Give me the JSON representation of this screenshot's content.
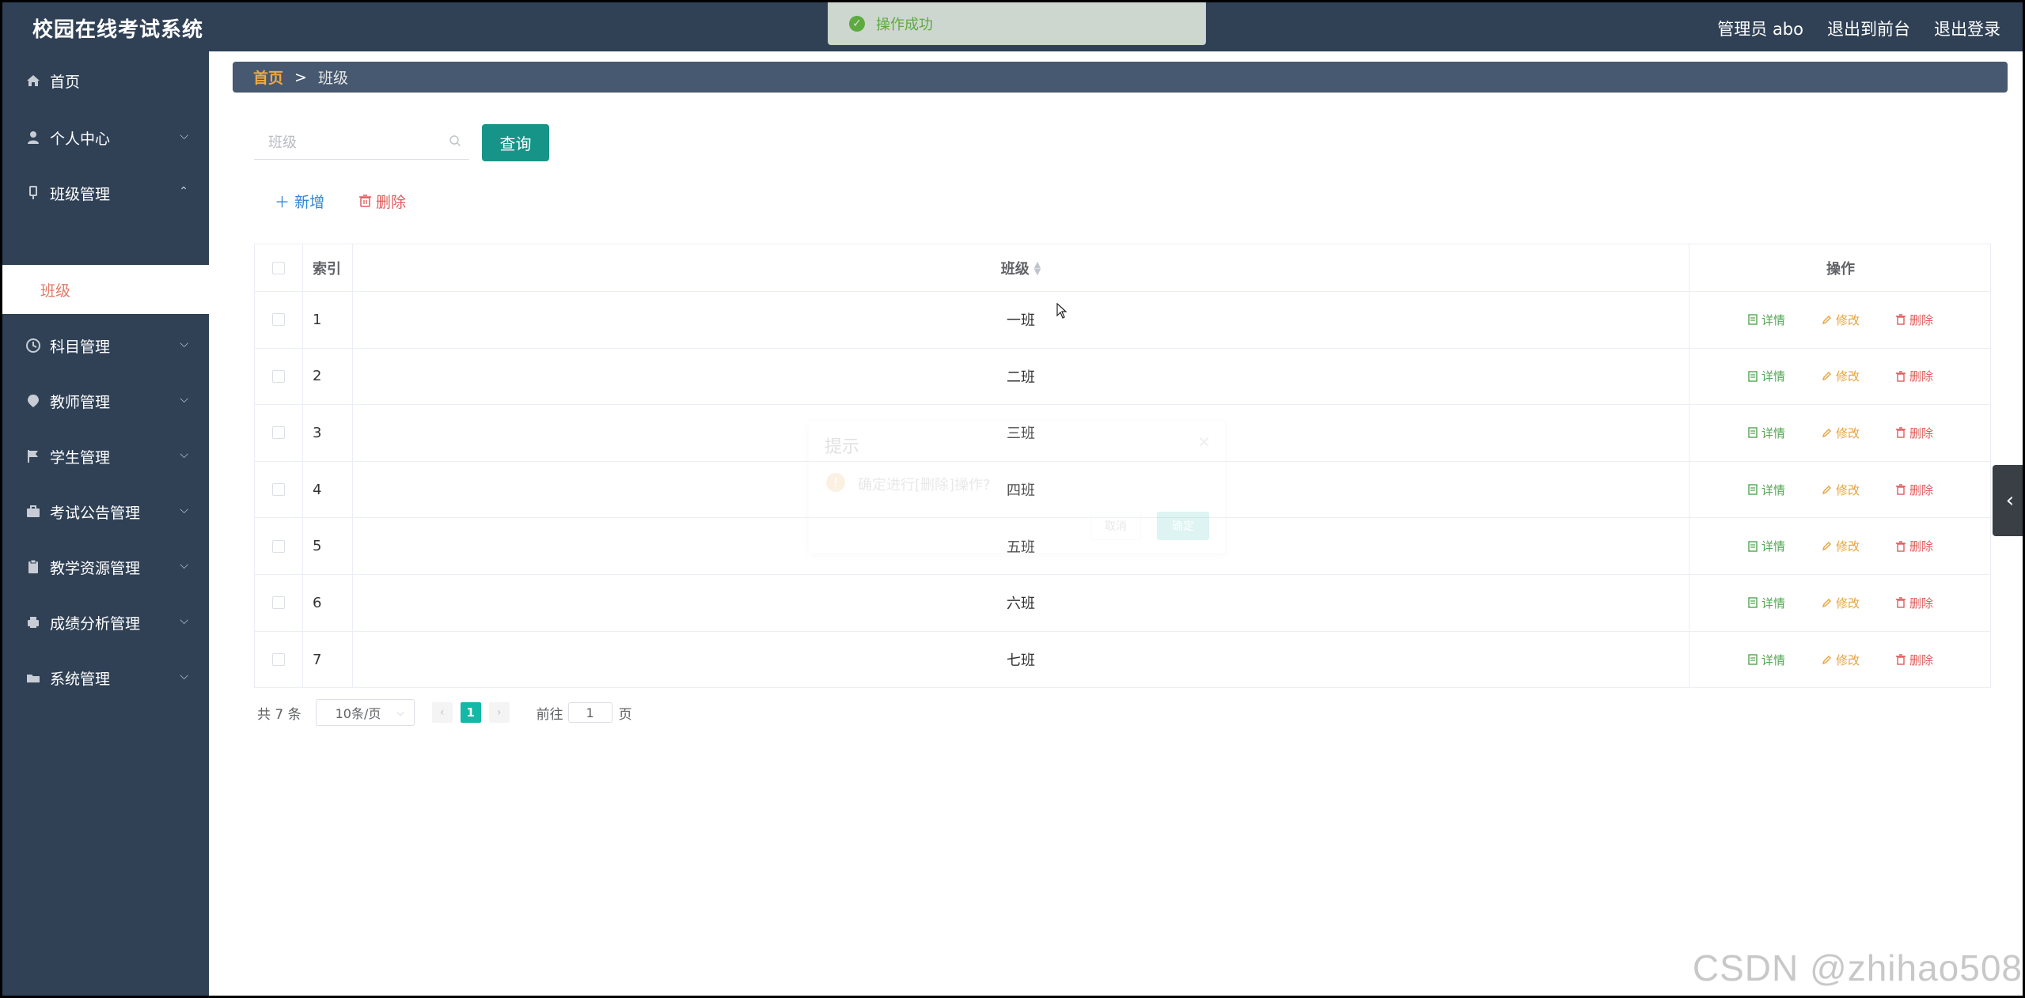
{
  "header": {
    "app_title": "校园在线考试系统",
    "user": "管理员 abo",
    "to_frontend": "退出到前台",
    "logout": "退出登录"
  },
  "toast": {
    "message": "操作成功"
  },
  "sidebar": {
    "items": [
      {
        "label": "首页",
        "icon": "home-icon",
        "expandable": false
      },
      {
        "label": "个人中心",
        "icon": "user-icon",
        "expandable": true
      },
      {
        "label": "班级管理",
        "icon": "class-icon",
        "expandable": true,
        "expanded": true
      },
      {
        "label": "科目管理",
        "icon": "clock-icon",
        "expandable": true
      },
      {
        "label": "教师管理",
        "icon": "location-icon",
        "expandable": true
      },
      {
        "label": "学生管理",
        "icon": "flag-icon",
        "expandable": true
      },
      {
        "label": "考试公告管理",
        "icon": "briefcase-icon",
        "expandable": true
      },
      {
        "label": "教学资源管理",
        "icon": "clipboard-icon",
        "expandable": true
      },
      {
        "label": "成绩分析管理",
        "icon": "printer-icon",
        "expandable": true
      },
      {
        "label": "系统管理",
        "icon": "folder-icon",
        "expandable": true
      }
    ],
    "submenu_active": "班级"
  },
  "breadcrumb": {
    "home": "首页",
    "separator": ">",
    "current": "班级"
  },
  "search": {
    "placeholder": "班级",
    "value": "",
    "query_label": "查询"
  },
  "actions": {
    "add_label": "新增",
    "delete_label": "删除"
  },
  "table": {
    "headers": {
      "index": "索引",
      "name": "班级",
      "operation": "操作"
    },
    "op_labels": {
      "detail": "详情",
      "edit": "修改",
      "delete": "删除"
    },
    "rows": [
      {
        "index": "1",
        "name": "一班"
      },
      {
        "index": "2",
        "name": "二班"
      },
      {
        "index": "3",
        "name": "三班"
      },
      {
        "index": "4",
        "name": "四班"
      },
      {
        "index": "5",
        "name": "五班"
      },
      {
        "index": "6",
        "name": "六班"
      },
      {
        "index": "7",
        "name": "七班"
      }
    ]
  },
  "pagination": {
    "total": "共 7 条",
    "page_size": "10条/页",
    "current_page": "1",
    "goto_label": "前往",
    "goto_value": "1",
    "page_unit": "页"
  },
  "dialog": {
    "title": "提示",
    "message": "确定进行[删除]操作?",
    "cancel": "取消",
    "confirm": "确定"
  },
  "watermark": "CSDN @zhihao508",
  "colors": {
    "sidebar_bg": "#304156",
    "primary": "#179488",
    "breadcrumb_home": "#f0a842",
    "detail": "#52a452",
    "edit": "#e6a23c",
    "delete": "#e05b5b",
    "add": "#2f86d6"
  }
}
